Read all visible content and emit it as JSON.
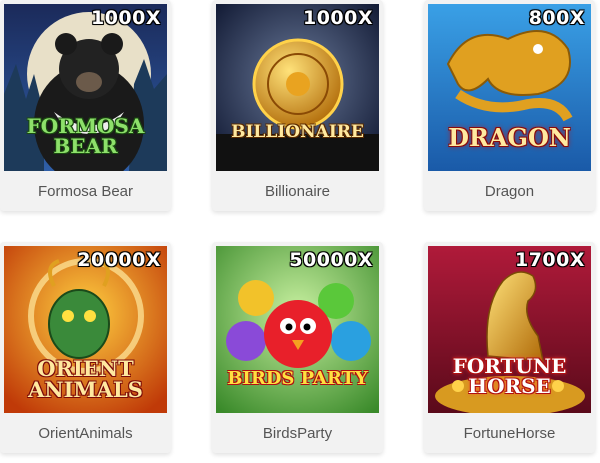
{
  "games": [
    {
      "name": "Formosa Bear",
      "multiplier": "1000X",
      "logo": [
        "FORMOSA",
        "BEAR"
      ]
    },
    {
      "name": "Billionaire",
      "multiplier": "1000X",
      "logo": [
        "BILLIONAIRE"
      ]
    },
    {
      "name": "Dragon",
      "multiplier": "800X",
      "logo": [
        "DRAGON"
      ]
    },
    {
      "name": "OrientAnimals",
      "multiplier": "20000X",
      "logo": [
        "ORIENT",
        "ANIMALS"
      ]
    },
    {
      "name": "BirdsParty",
      "multiplier": "50000X",
      "logo": [
        "BIRDS PARTY"
      ]
    },
    {
      "name": "FortuneHorse",
      "multiplier": "1700X",
      "logo": [
        "FORTUNE",
        "HORSE"
      ]
    }
  ],
  "colors": {
    "card_bg": "#f2f2f2",
    "caption_text": "#555555",
    "multiplier_text": "#ffffff"
  }
}
